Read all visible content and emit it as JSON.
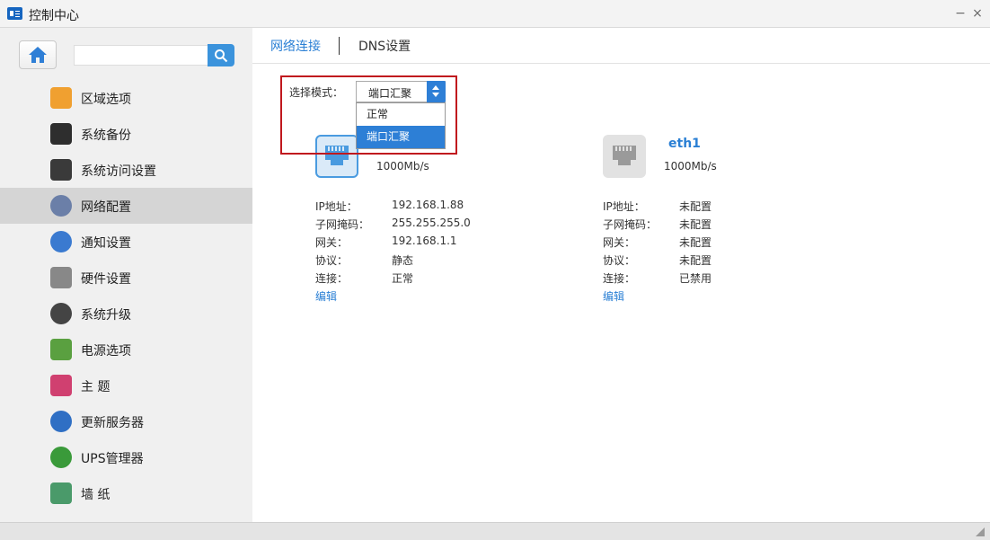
{
  "window": {
    "title": "控制中心",
    "minimize": "−",
    "close": "×"
  },
  "sidebar": {
    "search_placeholder": "",
    "items": [
      {
        "label": "区域选项",
        "icon": "region-icon",
        "color": "#f0a030"
      },
      {
        "label": "系统备份",
        "icon": "backup-icon",
        "color": "#2e2e2e"
      },
      {
        "label": "系统访问设置",
        "icon": "user-access-icon",
        "color": "#3a3a3a"
      },
      {
        "label": "网络配置",
        "icon": "network-icon",
        "color": "#6b7fa8",
        "active": true
      },
      {
        "label": "通知设置",
        "icon": "bell-icon",
        "color": "#3a7ad0"
      },
      {
        "label": "硬件设置",
        "icon": "tools-icon",
        "color": "#888888"
      },
      {
        "label": "系统升级",
        "icon": "globe-icon",
        "color": "#444444"
      },
      {
        "label": "电源选项",
        "icon": "battery-icon",
        "color": "#5aa040"
      },
      {
        "label": "主 题",
        "icon": "theme-icon",
        "color": "#d04070"
      },
      {
        "label": "更新服务器",
        "icon": "server-icon",
        "color": "#2f6fc4"
      },
      {
        "label": "UPS管理器",
        "icon": "ups-icon",
        "color": "#3a9a3a"
      },
      {
        "label": "墙 纸",
        "icon": "wallpaper-icon",
        "color": "#4a9a6a"
      }
    ]
  },
  "tabs": [
    {
      "label": "网络连接",
      "active": true
    },
    {
      "label": "DNS设置",
      "active": false
    }
  ],
  "mode": {
    "label": "选择模式：",
    "selected": "端口汇聚",
    "options": [
      "正常",
      "端口汇聚"
    ]
  },
  "adapters": [
    {
      "name": "",
      "speed": "1000Mb/s",
      "icon_color": "#4a9be0",
      "fields": [
        {
          "label": "IP地址：",
          "value": "192.168.1.88"
        },
        {
          "label": "子网掩码：",
          "value": "255.255.255.0"
        },
        {
          "label": "网关：",
          "value": "192.168.1.1"
        },
        {
          "label": "协议：",
          "value": "静态"
        },
        {
          "label": "连接：",
          "value": "正常"
        }
      ],
      "edit": "编辑"
    },
    {
      "name": "eth1",
      "speed": "1000Mb/s",
      "icon_color": "#9a9a9a",
      "fields": [
        {
          "label": "IP地址：",
          "value": "未配置"
        },
        {
          "label": "子网掩码：",
          "value": "未配置"
        },
        {
          "label": "网关：",
          "value": "未配置"
        },
        {
          "label": "协议：",
          "value": "未配置"
        },
        {
          "label": "连接：",
          "value": "已禁用"
        }
      ],
      "edit": "编辑"
    }
  ]
}
